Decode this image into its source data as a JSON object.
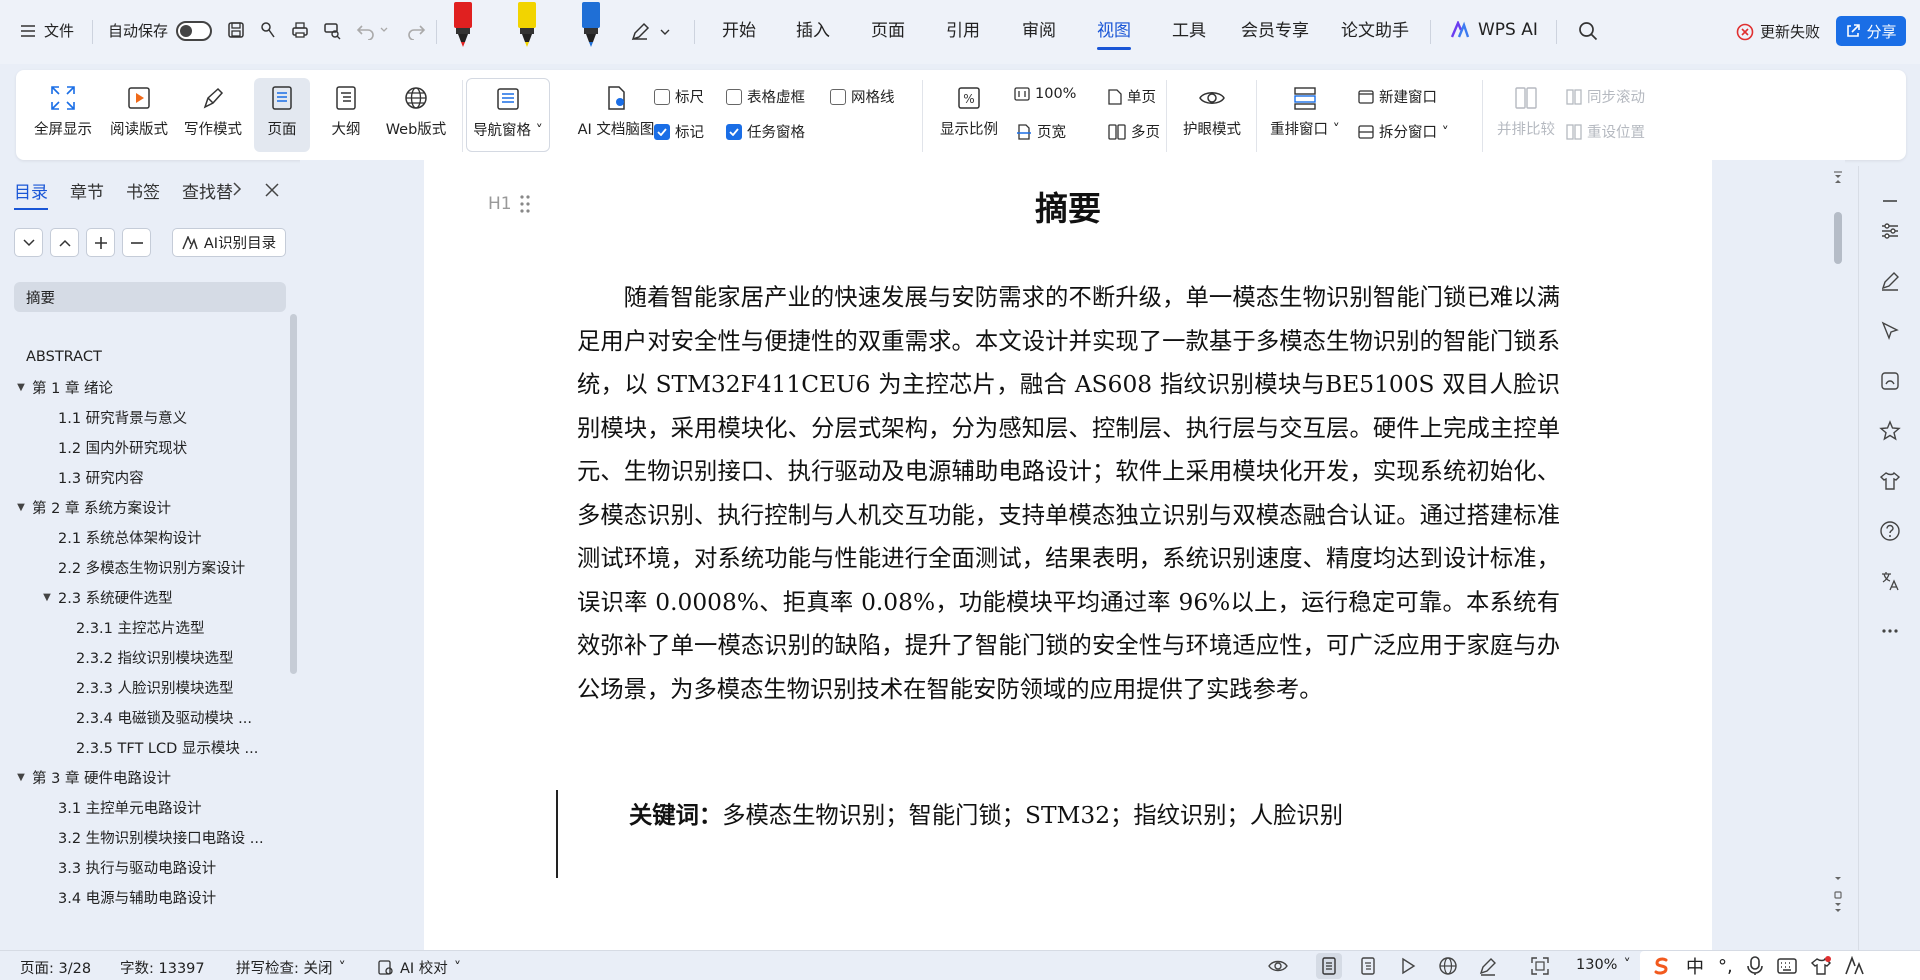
{
  "topbar": {
    "file_label": "文件",
    "autosave_label": "自动保存",
    "menu_tabs": [
      "开始",
      "插入",
      "页面",
      "引用",
      "审阅",
      "视图",
      "工具",
      "会员专享",
      "论文助手"
    ],
    "active_tab": "视图",
    "wps_ai_label": "WPS AI",
    "update_label": "更新失败",
    "share_label": "分享",
    "accent_color": "#1a56d6",
    "marker_colors": [
      "#e02020",
      "#f2d400",
      "#1f6fd6"
    ]
  },
  "ribbon": {
    "big_buttons": [
      "全屏显示",
      "阅读版式",
      "写作模式",
      "页面",
      "大纲",
      "Web版式",
      "导航窗格",
      "AI 文档脑图"
    ],
    "active_button": "页面",
    "checkboxes": [
      {
        "label": "标尺",
        "checked": false
      },
      {
        "label": "表格虚框",
        "checked": false
      },
      {
        "label": "网格线",
        "checked": false
      },
      {
        "label": "标记",
        "checked": true
      },
      {
        "label": "任务窗格",
        "checked": true
      }
    ],
    "zoom_group": {
      "ratio_label": "显示比例",
      "percent": "100%",
      "page_width": "页宽",
      "single_page": "单页",
      "multi_page": "多页"
    },
    "eye_mode": "护眼模式",
    "rearrange": "重排窗口",
    "new_window": "新建窗口",
    "split_window": "拆分窗口",
    "side_by_side": "并排比较",
    "sync_scroll": "同步滚动",
    "reset_position": "重设位置"
  },
  "nav": {
    "tabs": [
      "目录",
      "章节",
      "书签",
      "查找替"
    ],
    "active_tab": "目录",
    "ai_toc_label": "AI识别目录",
    "items": [
      {
        "label": "摘要",
        "level": 1,
        "selected": true,
        "caret": false
      },
      {
        "label": "ABSTRACT",
        "level": 1,
        "selected": false,
        "caret": false
      },
      {
        "label": "第 1 章  绪论",
        "level": 1,
        "selected": false,
        "caret": true
      },
      {
        "label": "1.1  研究背景与意义",
        "level": 2,
        "selected": false,
        "caret": false
      },
      {
        "label": "1.2  国内外研究现状",
        "level": 2,
        "selected": false,
        "caret": false
      },
      {
        "label": "1.3  研究内容",
        "level": 2,
        "selected": false,
        "caret": false
      },
      {
        "label": "第 2 章  系统方案设计",
        "level": 1,
        "selected": false,
        "caret": true
      },
      {
        "label": "2.1  系统总体架构设计",
        "level": 2,
        "selected": false,
        "caret": false
      },
      {
        "label": "2.2  多模态生物识别方案设计",
        "level": 2,
        "selected": false,
        "caret": false
      },
      {
        "label": "2.3  系统硬件选型",
        "level": 2,
        "selected": false,
        "caret": true
      },
      {
        "label": "2.3.1  主控芯片选型",
        "level": 3,
        "selected": false,
        "caret": false
      },
      {
        "label": "2.3.2  指纹识别模块选型",
        "level": 3,
        "selected": false,
        "caret": false
      },
      {
        "label": "2.3.3  人脸识别模块选型",
        "level": 3,
        "selected": false,
        "caret": false
      },
      {
        "label": "2.3.4  电磁锁及驱动模块 ...",
        "level": 3,
        "selected": false,
        "caret": false
      },
      {
        "label": "2.3.5 TFT LCD  显示模块 ...",
        "level": 3,
        "selected": false,
        "caret": false
      },
      {
        "label": "第 3 章  硬件电路设计",
        "level": 1,
        "selected": false,
        "caret": true
      },
      {
        "label": "3.1  主控单元电路设计",
        "level": 2,
        "selected": false,
        "caret": false
      },
      {
        "label": "3.2  生物识别模块接口电路设 ...",
        "level": 2,
        "selected": false,
        "caret": false
      },
      {
        "label": "3.3  执行与驱动电路设计",
        "level": 2,
        "selected": false,
        "caret": false
      },
      {
        "label": "3.4  电源与辅助电路设计",
        "level": 2,
        "selected": false,
        "caret": false
      }
    ]
  },
  "document": {
    "heading_marker": "H1",
    "title": "摘要",
    "abstract": "随着智能家居产业的快速发展与安防需求的不断升级，单一模态生物识别智能门锁已难以满足用户对安全性与便捷性的双重需求。本文设计并实现了一款基于多模态生物识别的智能门锁系统，以 STM32F411CEU6 为主控芯片，融合 AS608 指纹识别模块与BE5100S 双目人脸识别模块，采用模块化、分层式架构，分为感知层、控制层、执行层与交互层。硬件上完成主控单元、生物识别接口、执行驱动及电源辅助电路设计；软件上采用模块化开发，实现系统初始化、多模态识别、执行控制与人机交互功能，支持单模态独立识别与双模态融合认证。通过搭建标准测试环境，对系统功能与性能进行全面测试，结果表明，系统识别速度、精度均达到设计标准，误识率 0.0008%、拒真率 0.08%，功能模块平均通过率 96%以上，运行稳定可靠。本系统有效弥补了单一模态识别的缺陷，提升了智能门锁的安全性与环境适应性，可广泛应用于家庭与办公场景，为多模态生物识别技术在智能安防领域的应用提供了实践参考。",
    "keywords_label": "关键词：",
    "keywords": "多模态生物识别；智能门锁；STM32；指纹识别；人脸识别"
  },
  "statusbar": {
    "page": "页面: 3/28",
    "word_count": "字数: 13397",
    "spell_check": "拼写检查: 关闭",
    "ai_proof": "AI 校对",
    "zoom": "130%",
    "ime_chars": [
      "中",
      "°,"
    ]
  }
}
